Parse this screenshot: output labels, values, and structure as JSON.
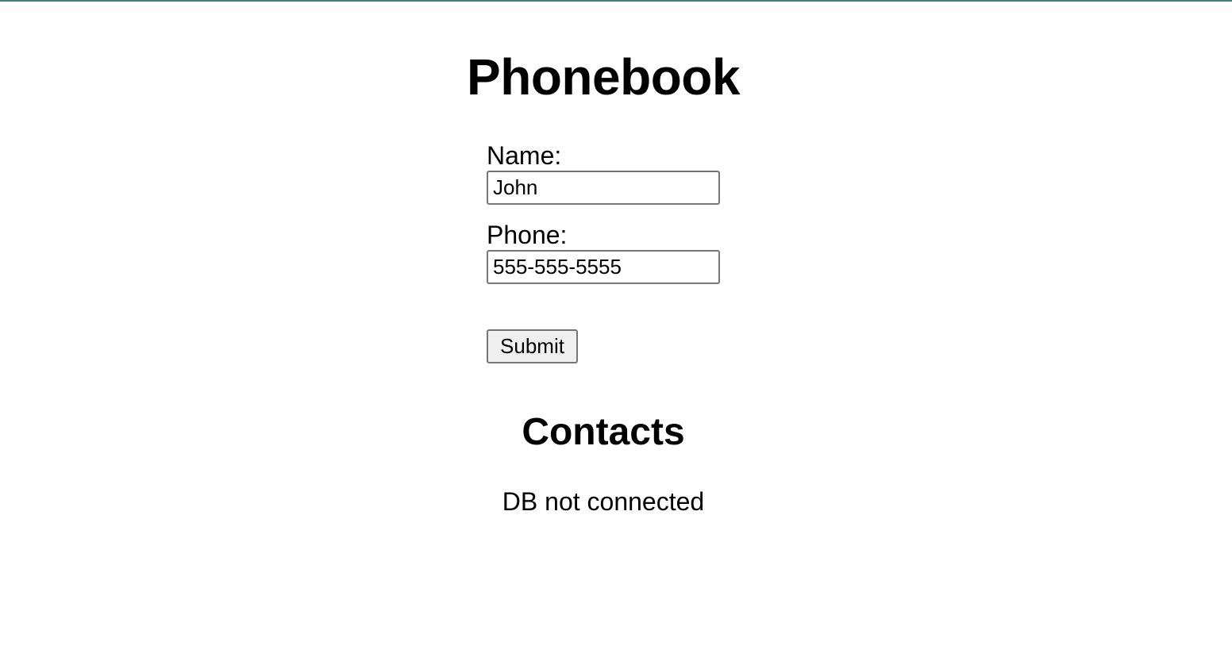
{
  "page": {
    "title": "Phonebook",
    "accent_color": "#3f7f80"
  },
  "form": {
    "name_label": "Name:",
    "name_value": "John",
    "phone_label": "Phone:",
    "phone_value": "555-555-5555",
    "submit_label": "Submit"
  },
  "contacts": {
    "heading": "Contacts",
    "status": "DB not connected"
  }
}
